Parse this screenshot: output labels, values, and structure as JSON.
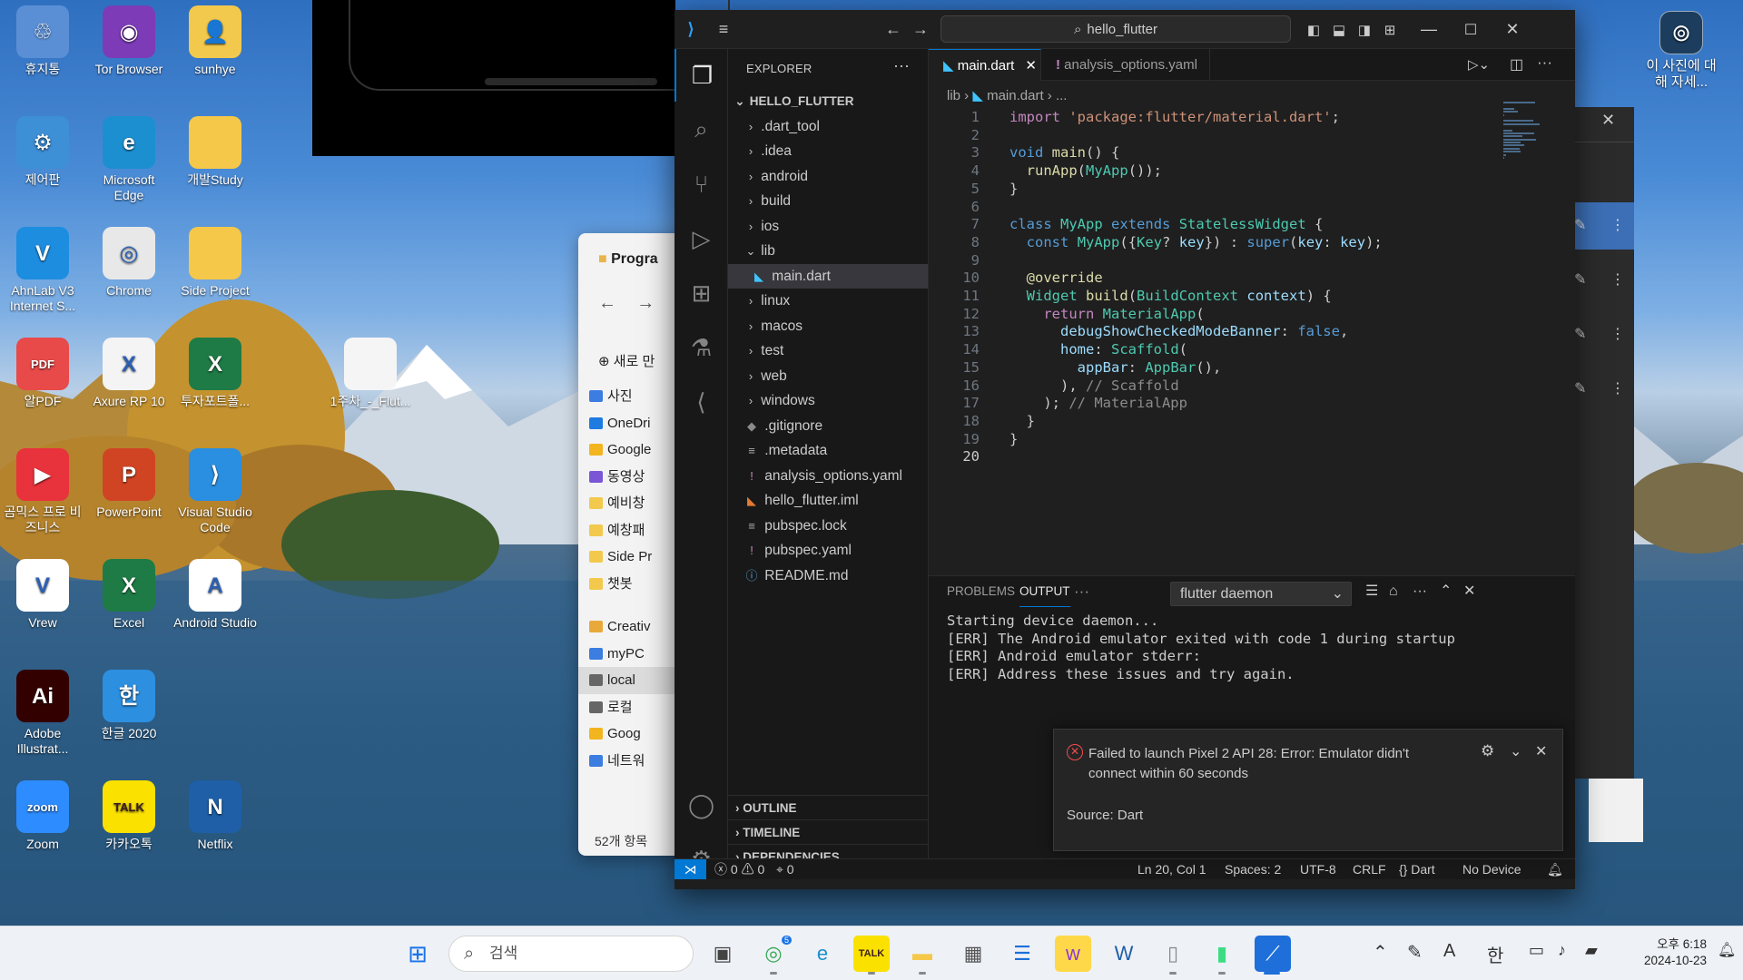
{
  "desktop": {
    "icons": [
      {
        "label": "휴지통",
        "color": "#5a8fd6",
        "glyph": "♲"
      },
      {
        "label": "Tor Browser",
        "color": "#7d3bb8",
        "glyph": "◉"
      },
      {
        "label": "sunhye",
        "color": "#f2c94c",
        "glyph": "👤"
      },
      {
        "label": "제어판",
        "color": "#3d8fd6",
        "glyph": "⚙"
      },
      {
        "label": "Microsoft Edge",
        "color": "#1c8fd0",
        "glyph": "e"
      },
      {
        "label": "개발Study",
        "color": "#f5c84a",
        "glyph": ""
      },
      {
        "label": "AhnLab V3 Internet S...",
        "color": "#1d8de0",
        "glyph": "V"
      },
      {
        "label": "Chrome",
        "color": "#e8e8e8",
        "glyph": "◎"
      },
      {
        "label": "Side Project",
        "color": "#f5c84a",
        "glyph": ""
      },
      {
        "label": "알PDF",
        "color": "#e84a4a",
        "glyph": "PDF"
      },
      {
        "label": "Axure RP 10",
        "color": "#f4f4f4",
        "glyph": "X"
      },
      {
        "label": "투자포트폴...",
        "color": "#1e7b45",
        "glyph": "X"
      },
      {
        "label": "1주차_-_Flut...",
        "color": "#f5f5f5",
        "glyph": ""
      },
      {
        "label": "곰믹스 프로 비즈니스",
        "color": "#e8323c",
        "glyph": "▶"
      },
      {
        "label": "PowerPoint",
        "color": "#d04423",
        "glyph": "P"
      },
      {
        "label": "Visual Studio Code",
        "color": "#2a8fe0",
        "glyph": "⟩"
      },
      {
        "label": "Vrew",
        "color": "#ffffff",
        "glyph": "V"
      },
      {
        "label": "Excel",
        "color": "#1e7b45",
        "glyph": "X"
      },
      {
        "label": "Android Studio",
        "color": "#ffffff",
        "glyph": "A"
      },
      {
        "label": "Adobe Illustrat...",
        "color": "#330000",
        "glyph": "Ai"
      },
      {
        "label": "한글 2020",
        "color": "#2d8fe0",
        "glyph": "한"
      },
      {
        "label": "Zoom",
        "color": "#2d8cff",
        "glyph": "zoom"
      },
      {
        "label": "카카오톡",
        "color": "#fae100",
        "glyph": "TALK"
      },
      {
        "label": "Netflix",
        "color": "#1e5fa8",
        "glyph": "N"
      }
    ],
    "corner_label": "이 사진에 대해 자세...",
    "corner_icon": "camera-icon"
  },
  "file_explorer": {
    "title": "Progra",
    "new_label": "새로 만",
    "sidebar": [
      "사진",
      "OneDri",
      "Google",
      "동영상",
      "예비창",
      "예창패",
      "Side Pr",
      "챗봇",
      "Creativ",
      "myPC",
      "local",
      "로컬",
      "Goog",
      "네트워"
    ],
    "item_count": "52개 항목"
  },
  "vscode": {
    "search": "hello_flutter",
    "explorer_header": "EXPLORER",
    "root": "HELLO_FLUTTER",
    "tree": [
      {
        "name": ".dart_tool",
        "type": "folder",
        "open": false,
        "depth": 1
      },
      {
        "name": ".idea",
        "type": "folder",
        "open": false,
        "depth": 1
      },
      {
        "name": "android",
        "type": "folder",
        "open": false,
        "depth": 1
      },
      {
        "name": "build",
        "type": "folder",
        "open": false,
        "depth": 1
      },
      {
        "name": "ios",
        "type": "folder",
        "open": false,
        "depth": 1
      },
      {
        "name": "lib",
        "type": "folder",
        "open": true,
        "depth": 1
      },
      {
        "name": "main.dart",
        "type": "dart",
        "depth": 2,
        "selected": true
      },
      {
        "name": "linux",
        "type": "folder",
        "open": false,
        "depth": 1
      },
      {
        "name": "macos",
        "type": "folder",
        "open": false,
        "depth": 1
      },
      {
        "name": "test",
        "type": "folder",
        "open": false,
        "depth": 1
      },
      {
        "name": "web",
        "type": "folder",
        "open": false,
        "depth": 1
      },
      {
        "name": "windows",
        "type": "folder",
        "open": false,
        "depth": 1
      },
      {
        "name": ".gitignore",
        "type": "git",
        "depth": 1
      },
      {
        "name": ".metadata",
        "type": "file",
        "depth": 1
      },
      {
        "name": "analysis_options.yaml",
        "type": "yaml",
        "depth": 1
      },
      {
        "name": "hello_flutter.iml",
        "type": "rss",
        "depth": 1
      },
      {
        "name": "pubspec.lock",
        "type": "file",
        "depth": 1
      },
      {
        "name": "pubspec.yaml",
        "type": "yaml",
        "depth": 1
      },
      {
        "name": "README.md",
        "type": "info",
        "depth": 1
      }
    ],
    "sections": [
      "OUTLINE",
      "TIMELINE",
      "DEPENDENCIES"
    ],
    "tabs": [
      {
        "label": "main.dart",
        "active": true
      },
      {
        "label": "analysis_options.yaml",
        "active": false
      }
    ],
    "breadcrumb": [
      "lib",
      "main.dart",
      "..."
    ],
    "line_numbers": [
      "1",
      "2",
      "3",
      "4",
      "5",
      "6",
      "7",
      "8",
      "9",
      "10",
      "11",
      "12",
      "13",
      "14",
      "15",
      "16",
      "17",
      "18",
      "19",
      "20"
    ],
    "code": [
      "import 'package:flutter/material.dart';",
      "",
      "void main() {",
      "  runApp(MyApp());",
      "}",
      "",
      "class MyApp extends StatelessWidget {",
      "  const MyApp({Key? key}) : super(key: key);",
      "",
      "  @override",
      "  Widget build(BuildContext context) {",
      "    return MaterialApp(",
      "      debugShowCheckedModeBanner: false,",
      "      home: Scaffold(",
      "        appBar: AppBar(),",
      "      ), // Scaffold",
      "    ); // MaterialApp",
      "  }",
      "}",
      ""
    ],
    "panel": {
      "tabs": [
        "PROBLEMS",
        "OUTPUT"
      ],
      "active_tab": "OUTPUT",
      "channel": "flutter daemon",
      "lines": [
        "Starting device daemon...",
        "[ERR] The Android emulator exited with code 1 during startup",
        "[ERR] Android emulator stderr:",
        "[ERR] Address these issues and try again."
      ]
    },
    "notification": {
      "message": "Failed to launch Pixel 2 API 28: Error: Emulator didn't connect within 60 seconds",
      "source": "Source: Dart"
    },
    "status": {
      "errors": "0",
      "warnings": "0",
      "ports": "0",
      "position": "Ln 20, Col 1",
      "spaces": "Spaces: 2",
      "encoding": "UTF-8",
      "eol": "CRLF",
      "language": "Dart",
      "device": "No Device"
    }
  },
  "taskbar": {
    "search_placeholder": "검색",
    "clock_time": "오후 6:18",
    "clock_date": "2024-10-23",
    "ime_a": "A",
    "ime_han": "한",
    "chrome_badge": "5"
  },
  "colors": {
    "accent": "#0078d4",
    "error": "#f14c4c"
  }
}
